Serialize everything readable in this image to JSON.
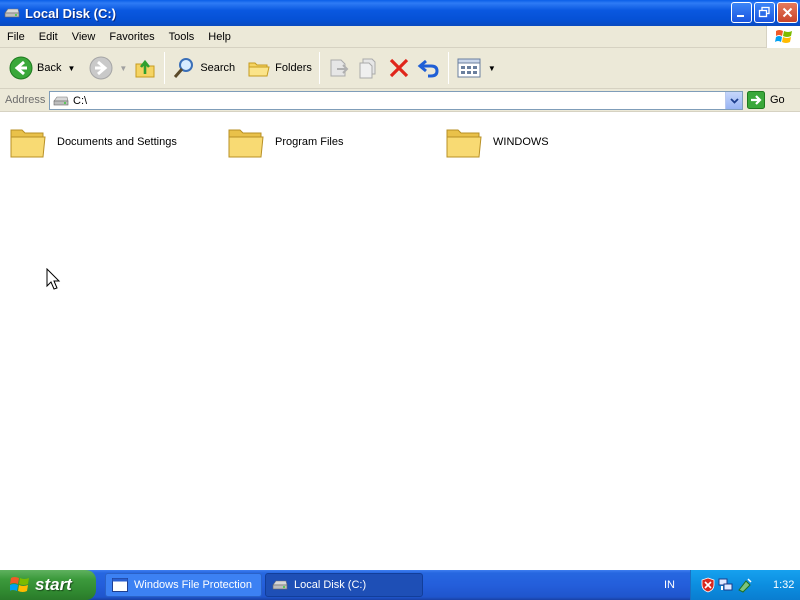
{
  "window": {
    "title": "Local Disk (C:)"
  },
  "menu": [
    "File",
    "Edit",
    "View",
    "Favorites",
    "Tools",
    "Help"
  ],
  "toolbar": {
    "back": "Back",
    "search": "Search",
    "folders": "Folders"
  },
  "address": {
    "label": "Address",
    "value": "C:\\",
    "go": "Go"
  },
  "folders": [
    {
      "name": "Documents and Settings"
    },
    {
      "name": "Program Files"
    },
    {
      "name": "WINDOWS"
    }
  ],
  "taskbar": {
    "start": "start",
    "tasks": [
      {
        "label": "Windows File Protection",
        "active": false
      },
      {
        "label": "Local Disk (C:)",
        "active": true
      }
    ],
    "language": "IN",
    "clock": "1:32"
  },
  "colors": {
    "titlebar": "#0a58e0",
    "chrome": "#ece9d8",
    "start": "#3c9a3c",
    "tray": "#0c8ee0",
    "folder": "#f5d463"
  }
}
